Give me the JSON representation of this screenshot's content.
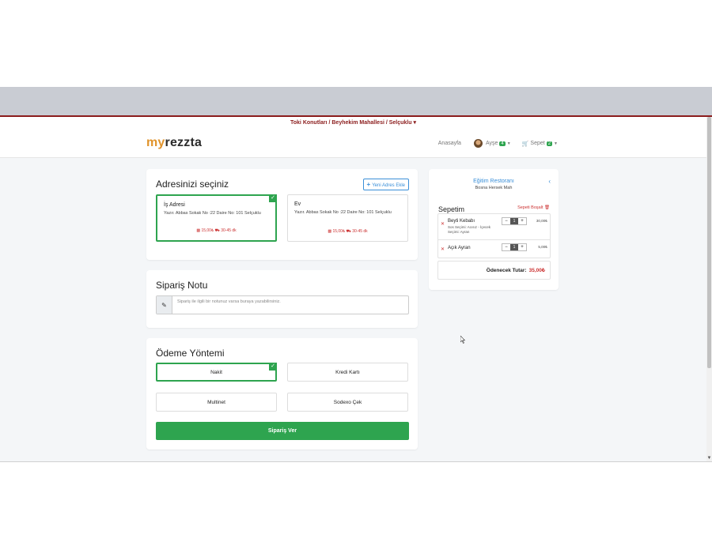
{
  "location": "Toki Konutları / Beyhekim Mahallesi / Selçuklu",
  "logo": {
    "prefix": "my",
    "rest": "rezzta"
  },
  "nav": {
    "home": "Anasayfa",
    "user": "Ayşe",
    "user_badge": "4",
    "cart": "Sepet",
    "cart_badge": "2"
  },
  "address": {
    "title": "Adresinizi seçiniz",
    "new_button": "Yeni Adres Ekle",
    "items": [
      {
        "title": "İş Adresi",
        "text": "Yazır. Abbas Sokak No :22 Daire No: 101 Selçuklu",
        "min": "15,00₺",
        "time": "30-45 dk",
        "selected": true
      },
      {
        "title": "Ev",
        "text": "Yazır. Abbas Sokak No :22 Daire No: 101 Selçuklu",
        "min": "15,00₺",
        "time": "30-45 dk",
        "selected": false
      }
    ]
  },
  "note": {
    "title": "Sipariş Notu",
    "placeholder": "Sipariş ile ilgili bir notunuz varsa buraya yazabilirsiniz."
  },
  "payment": {
    "title": "Ödeme Yöntemi",
    "options": [
      "Nakit",
      "Kredi Kartı",
      "Multinet",
      "Sodexo Çek"
    ],
    "selected": "Nakit",
    "order_button": "Sipariş Ver"
  },
  "cart": {
    "restaurant": "Eğitim Restoranı",
    "location": "Bosna Hersek Mah",
    "title": "Sepetim",
    "clear": "Sepeti Boşalt",
    "items": [
      {
        "name": "Beyti Kebabı",
        "desc": "Sos Seçimi: Acısız - İçecek Seçimi: Ayran",
        "qty": "1",
        "price": "30,00₺"
      },
      {
        "name": "Açık Ayran",
        "desc": "",
        "qty": "1",
        "price": "5,00₺"
      }
    ],
    "total_label": "Ödenecek Tutar:",
    "total": "35,00₺"
  },
  "colors": {
    "accent": "#2ea44f",
    "brand": "#e0932b",
    "link": "#3a8fd8",
    "danger": "#c33333"
  }
}
